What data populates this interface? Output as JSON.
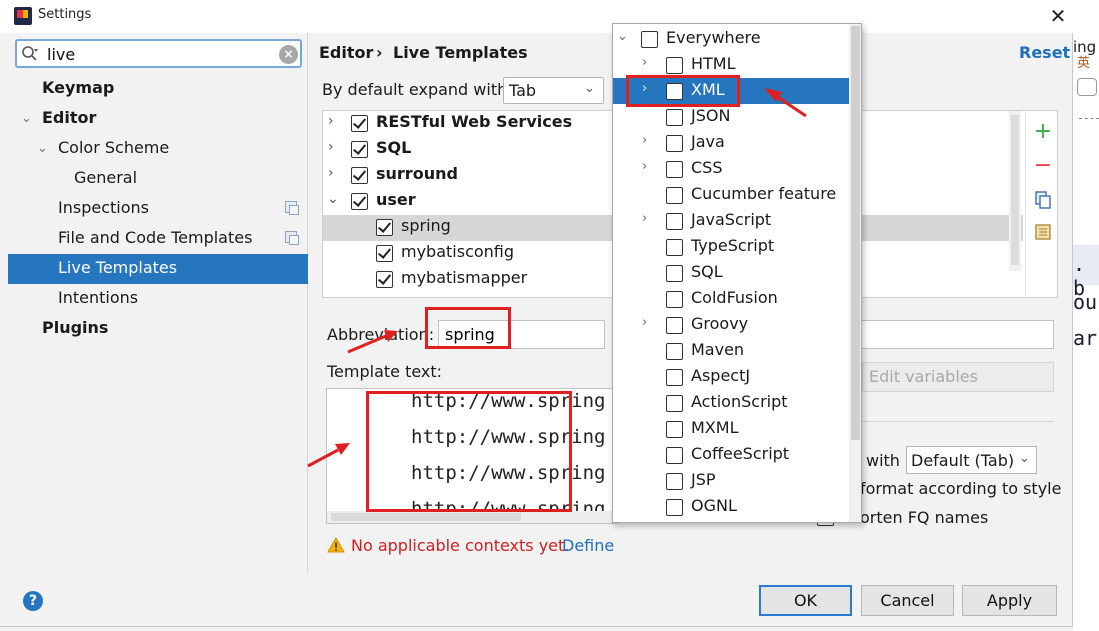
{
  "window": {
    "title": "Settings",
    "close_symbol": "✕"
  },
  "sidebar": {
    "search_value": "live",
    "clear_symbol": "×",
    "items": [
      {
        "label": "Keymap"
      },
      {
        "label": "Editor"
      },
      {
        "label": "Color Scheme"
      },
      {
        "label": "General"
      },
      {
        "label": "Inspections"
      },
      {
        "label": "File and Code Templates"
      },
      {
        "label": "Live Templates"
      },
      {
        "label": "Intentions"
      },
      {
        "label": "Plugins"
      }
    ]
  },
  "header": {
    "breadcrumb": [
      "Editor",
      "›",
      "Live Templates"
    ],
    "reset_label": "Reset"
  },
  "expand": {
    "label": "By default expand with",
    "value": "Tab"
  },
  "tree": {
    "rows": [
      {
        "label": "RESTful Web Services",
        "checked": true
      },
      {
        "label": "SQL",
        "checked": true
      },
      {
        "label": "surround",
        "checked": true
      },
      {
        "label": "user",
        "checked": true
      },
      {
        "label": "spring",
        "checked": true
      },
      {
        "label": "mybatisconfig",
        "checked": true
      },
      {
        "label": "mybatismapper",
        "checked": true
      }
    ],
    "toolbar": {
      "add": "+",
      "remove": "−"
    }
  },
  "editor": {
    "abbreviation_label": "Abbreviation:",
    "abbreviation_value": "spring",
    "template_label": "Template text:",
    "template_lines": [
      "http://www.spring",
      "http://www.spring",
      "http://www.spring",
      "http://www.spring"
    ],
    "edit_variables_label": "Edit variables",
    "expand_with_label": "with",
    "expand_with_value": "Default (Tab)",
    "reformat_label": "format according to style",
    "shorten_label": "orten FQ names"
  },
  "warning": {
    "text": "No applicable contexts yet.",
    "link": "Define"
  },
  "buttons": {
    "help": "?",
    "ok": "OK",
    "cancel": "Cancel",
    "apply": "Apply"
  },
  "context_popup": {
    "items": [
      {
        "label": "Everywhere"
      },
      {
        "label": "HTML"
      },
      {
        "label": "XML"
      },
      {
        "label": "JSON"
      },
      {
        "label": "Java"
      },
      {
        "label": "CSS"
      },
      {
        "label": "Cucumber feature"
      },
      {
        "label": "JavaScript"
      },
      {
        "label": "TypeScript"
      },
      {
        "label": "SQL"
      },
      {
        "label": "ColdFusion"
      },
      {
        "label": "Groovy"
      },
      {
        "label": "Maven"
      },
      {
        "label": "AspectJ"
      },
      {
        "label": "ActionScript"
      },
      {
        "label": "MXML"
      },
      {
        "label": "CoffeeScript"
      },
      {
        "label": "JSP"
      },
      {
        "label": "OGNL"
      }
    ]
  },
  "background_app": {
    "texts": [
      "ing",
      "英",
      ". b",
      "ou",
      "ar"
    ]
  },
  "colors": {
    "accent": "#2675bf",
    "annotation_red": "#e02020",
    "warning_red": "#d12020",
    "link_blue": "#1f6fc0"
  }
}
